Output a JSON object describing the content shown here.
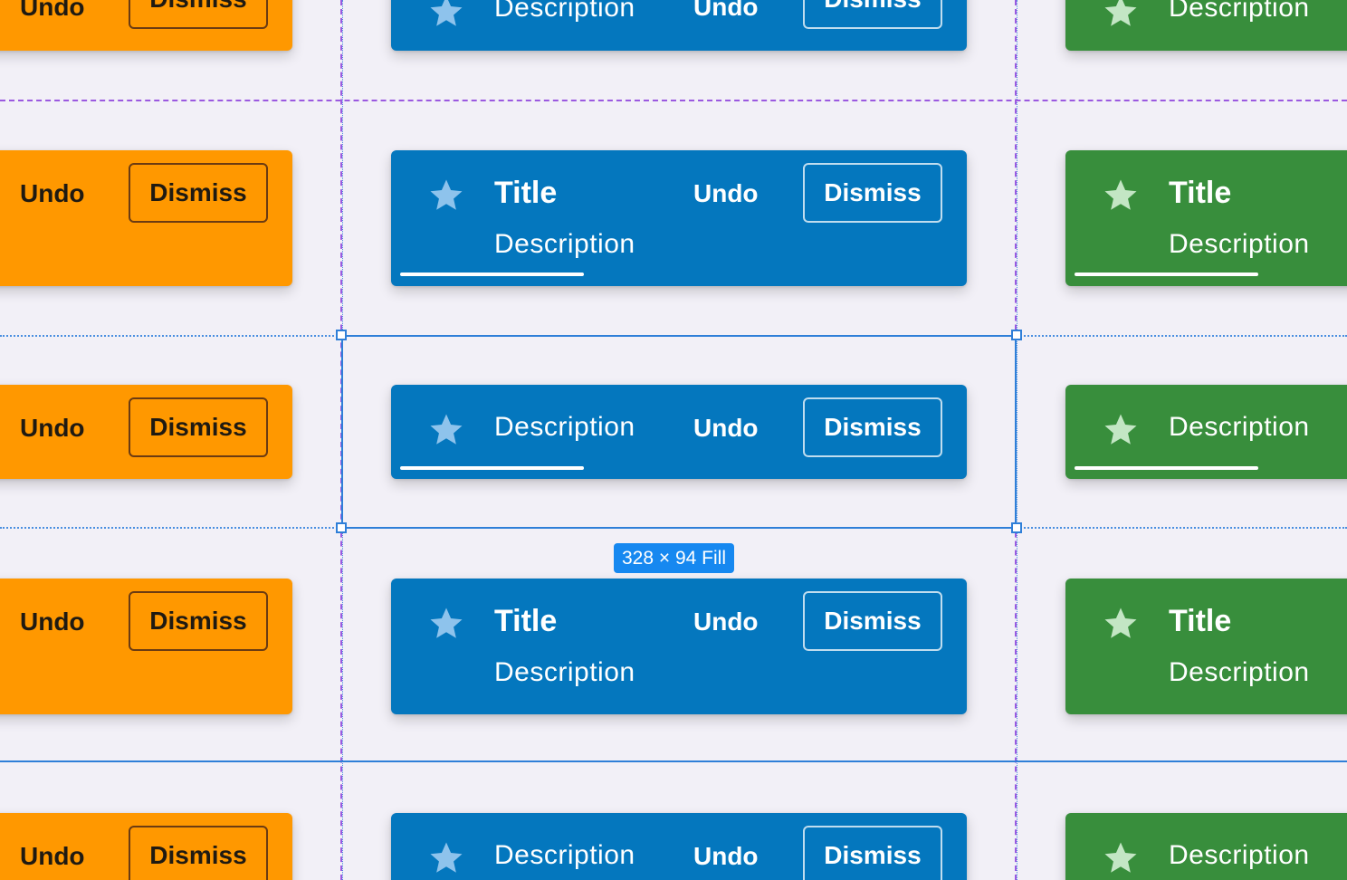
{
  "colors": {
    "canvas_bg": "#f2f0f7",
    "orange": "#ff9800",
    "blue": "#0477be",
    "green": "#388e3c",
    "guide_purple": "#9b59e0",
    "selection_blue": "#2f7fd8",
    "badge_blue": "#1688f0"
  },
  "icons": {
    "leading": "star-icon"
  },
  "snackbar": {
    "title": "Title",
    "description": "Description",
    "undo_label": "Undo",
    "dismiss_label": "Dismiss"
  },
  "selection": {
    "size_label": "328 × 94 Fill"
  }
}
